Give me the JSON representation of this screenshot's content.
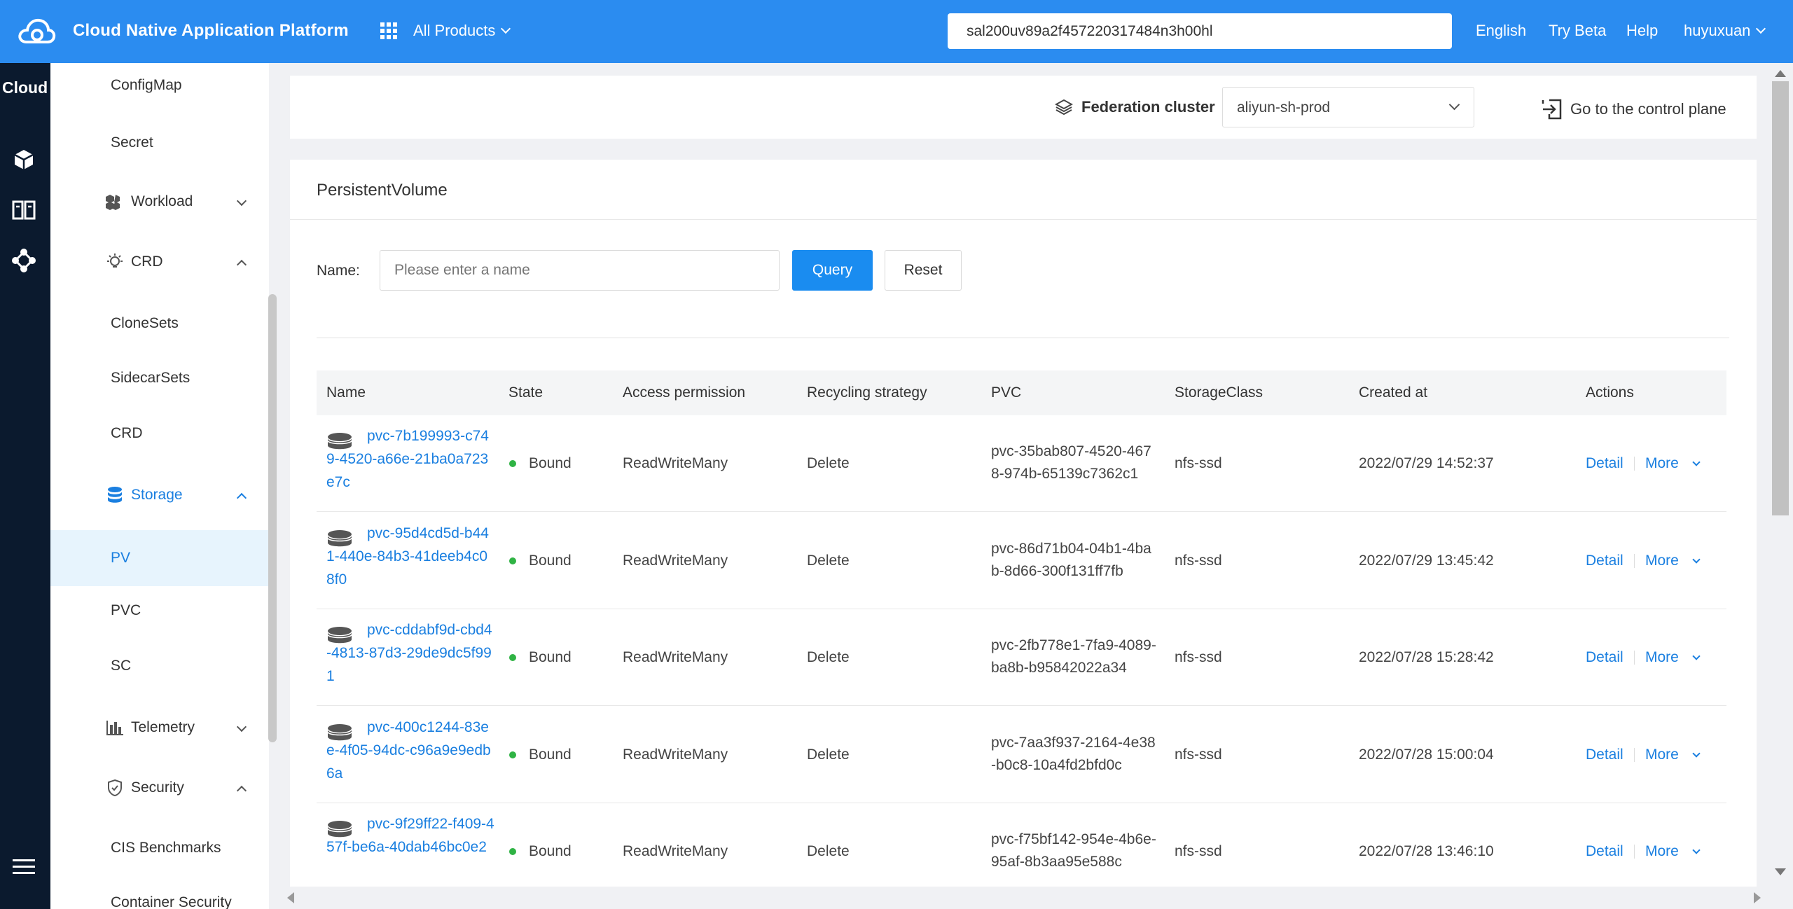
{
  "header": {
    "brand": "Cloud Native Application Platform",
    "products_label": "All Products",
    "search_value": "sal200uv89a2f457220317484n3h00hl",
    "language": "English",
    "try_beta": "Try Beta",
    "help": "Help",
    "user": "huyuxuan"
  },
  "rail": {
    "title": "Cloud",
    "icons": [
      "cube-icon",
      "book-icon",
      "cluster-icon",
      "menu-icon"
    ]
  },
  "sidebar": {
    "items": [
      {
        "label": "ConfigMap"
      },
      {
        "label": "Secret"
      },
      {
        "label": "Workload"
      },
      {
        "label": "CRD"
      },
      {
        "label": "CloneSets"
      },
      {
        "label": "SidecarSets"
      },
      {
        "label": "CRD"
      },
      {
        "label": "Storage"
      },
      {
        "label": "PV"
      },
      {
        "label": "PVC"
      },
      {
        "label": "SC"
      },
      {
        "label": "Telemetry"
      },
      {
        "label": "Security"
      },
      {
        "label": "CIS Benchmarks"
      },
      {
        "label": "Container Security"
      }
    ]
  },
  "cluster_bar": {
    "label": "Federation cluster",
    "selected": "aliyun-sh-prod",
    "goto_label": "Go to the control plane"
  },
  "panel": {
    "title": "PersistentVolume",
    "name_label": "Name",
    "name_placeholder": "Please enter a name",
    "query_label": "Query",
    "reset_label": "Reset"
  },
  "table": {
    "columns": [
      "Name",
      "State",
      "Access permission",
      "Recycling strategy",
      "PVC",
      "StorageClass",
      "Created at",
      "Actions"
    ],
    "rows": [
      {
        "name": "pvc-7b199993-c749-4520-a66e-21ba0a723e7c",
        "state": "Bound",
        "access": "ReadWriteMany",
        "recycle": "Delete",
        "pvc": "pvc-35bab807-4520-4678-974b-65139c7362c1",
        "storage_class": "nfs-ssd",
        "created": "2022/07/29 14:52:37",
        "detail": "Detail",
        "more": "More"
      },
      {
        "name": "pvc-95d4cd5d-b441-440e-84b3-41deeb4c08f0",
        "state": "Bound",
        "access": "ReadWriteMany",
        "recycle": "Delete",
        "pvc": "pvc-86d71b04-04b1-4bab-8d66-300f131ff7fb",
        "storage_class": "nfs-ssd",
        "created": "2022/07/29 13:45:42",
        "detail": "Detail",
        "more": "More"
      },
      {
        "name": "pvc-cddabf9d-cbd4-4813-87d3-29de9dc5f991",
        "state": "Bound",
        "access": "ReadWriteMany",
        "recycle": "Delete",
        "pvc": "pvc-2fb778e1-7fa9-4089-ba8b-b95842022a34",
        "storage_class": "nfs-ssd",
        "created": "2022/07/28 15:28:42",
        "detail": "Detail",
        "more": "More"
      },
      {
        "name": "pvc-400c1244-83ee-4f05-94dc-c96a9e9edb6a",
        "state": "Bound",
        "access": "ReadWriteMany",
        "recycle": "Delete",
        "pvc": "pvc-7aa3f937-2164-4e38-b0c8-10a4fd2bfd0c",
        "storage_class": "nfs-ssd",
        "created": "2022/07/28 15:00:04",
        "detail": "Detail",
        "more": "More"
      },
      {
        "name": "pvc-9f29ff22-f409-457f-be6a-40dab46bc0e2",
        "state": "Bound",
        "access": "ReadWriteMany",
        "recycle": "Delete",
        "pvc": "pvc-f75bf142-954e-4b6e-95af-8b3aa95e588c",
        "storage_class": "nfs-ssd",
        "created": "2022/07/28 13:46:10",
        "detail": "Detail",
        "more": "More"
      }
    ]
  },
  "colors": {
    "header_bg": "#2b8cf0",
    "rail_bg": "#0b1a2e",
    "link": "#1a7fe0",
    "bound_dot": "#2fb344",
    "active_item_bg": "#e7f4fd"
  }
}
